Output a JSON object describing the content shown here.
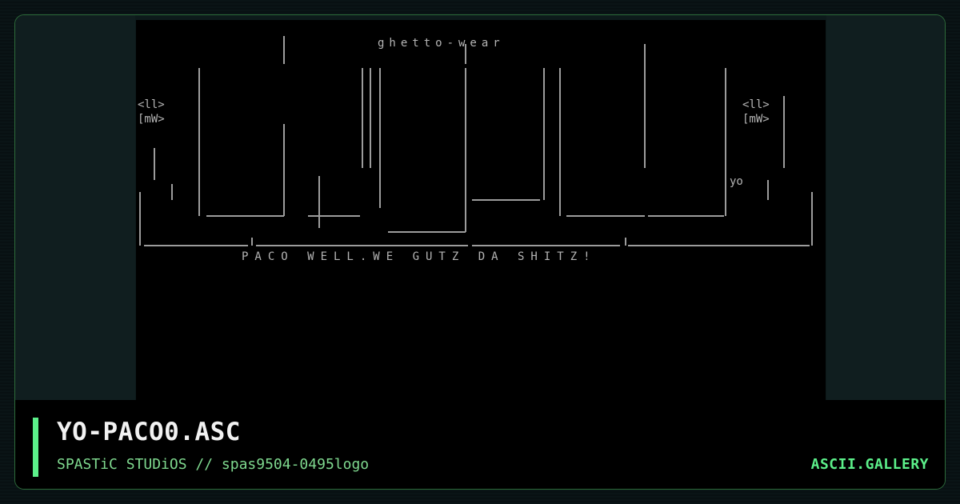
{
  "card": {
    "title": "YO-PACO0.ASC",
    "subtitle": "SPASTiC STUDiOS // spas9504-0495logo",
    "brand": "ASCII.GALLERY"
  },
  "artwork": {
    "header_text": "ghetto-wear",
    "side_tag_left": "<ll>\n[mW>",
    "side_tag_right": "<ll>\n[mW>",
    "yo_tag": "yo",
    "bottom_text": "PACO WELL.WE GUTZ DA SHITZ!"
  },
  "colors": {
    "accent": "#5cf08a",
    "border": "#2d6b3a",
    "art": "#c8c8c8"
  }
}
